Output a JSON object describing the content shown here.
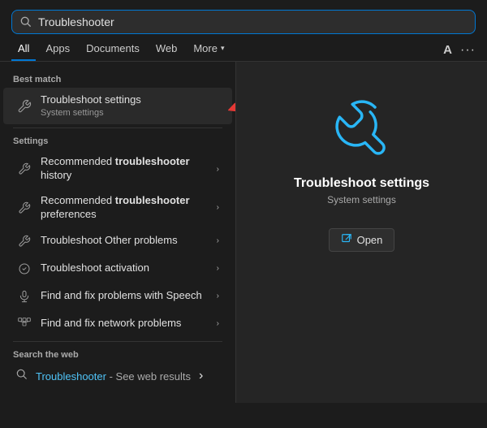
{
  "searchbar": {
    "value": "Troubleshooter",
    "placeholder": "Troubleshooter"
  },
  "tabs": [
    {
      "label": "All",
      "active": true
    },
    {
      "label": "Apps",
      "active": false
    },
    {
      "label": "Documents",
      "active": false
    },
    {
      "label": "Web",
      "active": false
    },
    {
      "label": "More",
      "active": false,
      "hasChevron": true
    }
  ],
  "header_right": {
    "font_label": "A",
    "more_label": "···"
  },
  "best_match_label": "Best match",
  "best_match": {
    "title": "Troubleshoot settings",
    "subtitle": "System settings"
  },
  "settings_label": "Settings",
  "settings_items": [
    {
      "id": "rec-history",
      "text_pre": "Recommended ",
      "text_bold": "troubleshooter",
      "text_post": " history"
    },
    {
      "id": "rec-prefs",
      "text_pre": "Recommended ",
      "text_bold": "troubleshooter",
      "text_post": " preferences"
    },
    {
      "id": "other-problems",
      "text_pre": "Troubleshoot Other problems",
      "text_bold": "",
      "text_post": ""
    },
    {
      "id": "activation",
      "text_pre": "Troubleshoot activation",
      "text_bold": "",
      "text_post": ""
    },
    {
      "id": "speech",
      "text_pre": "Find and fix problems with Speech",
      "text_bold": "",
      "text_post": ""
    },
    {
      "id": "network",
      "text_pre": "Find and fix network problems",
      "text_bold": "",
      "text_post": ""
    }
  ],
  "search_web_label": "Search the web",
  "web_item": {
    "text": "Troubleshooter",
    "suffix": " - See web results"
  },
  "right_panel": {
    "title": "Troubleshoot settings",
    "subtitle": "System settings",
    "open_label": "Open"
  }
}
